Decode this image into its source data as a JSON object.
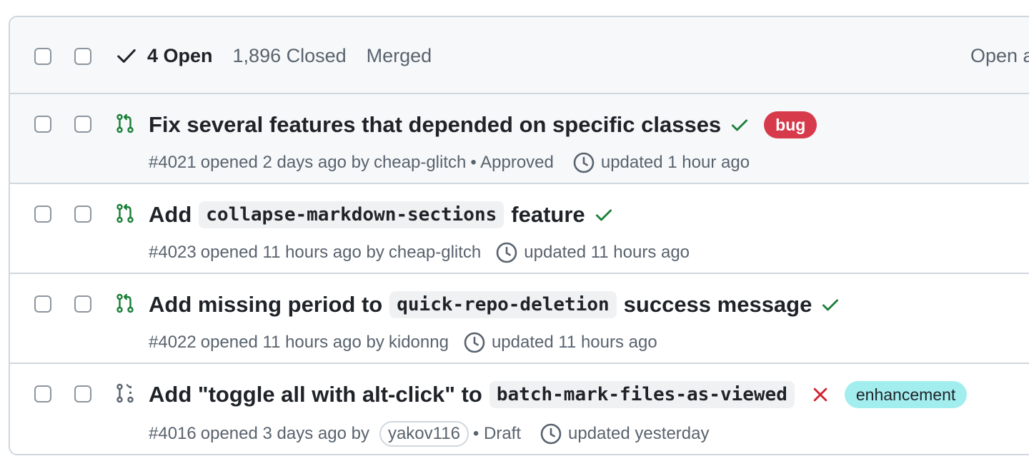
{
  "header": {
    "open_label": "4 Open",
    "closed_label": "1,896 Closed",
    "merged_label": "Merged",
    "right_label": "Open a"
  },
  "pull_requests": [
    {
      "title_parts": [
        "Fix several features that depended on specific classes"
      ],
      "code": [],
      "status": "success",
      "label": "bug",
      "number": "#4021",
      "opened": "opened 2 days ago by",
      "author": "cheap-glitch",
      "review": "• Approved",
      "updated": "updated 1 hour ago",
      "icon": "git-pull-request-icon"
    },
    {
      "title_parts": [
        "Add",
        "feature"
      ],
      "code": [
        "collapse-markdown-sections"
      ],
      "status": "success",
      "label": "",
      "number": "#4023",
      "opened": "opened 11 hours ago by",
      "author": "cheap-glitch",
      "review": "",
      "updated": "updated 11 hours ago",
      "icon": "git-pull-request-icon"
    },
    {
      "title_parts": [
        "Add missing period to",
        "success message"
      ],
      "code": [
        "quick-repo-deletion"
      ],
      "status": "success",
      "label": "",
      "number": "#4022",
      "opened": "opened 11 hours ago by",
      "author": "kidonng",
      "review": "",
      "updated": "updated 11 hours ago",
      "icon": "git-pull-request-icon"
    },
    {
      "title_parts": [
        "Add \"toggle all with alt-click\" to"
      ],
      "code": [
        "batch-mark-files-as-viewed"
      ],
      "status": "failure",
      "label": "enhancement",
      "number": "#4016",
      "opened": "opened 3 days ago by",
      "author": "yakov116",
      "review": "• Draft",
      "updated": "updated yesterday",
      "icon": "git-pull-request-draft-icon"
    }
  ],
  "colors": {
    "open_green": "#1a7f37",
    "draft_gray": "#59636e",
    "failure_red": "#cf222e",
    "bug_label": "#d73a4a",
    "enhancement_label": "#a2eeef"
  }
}
